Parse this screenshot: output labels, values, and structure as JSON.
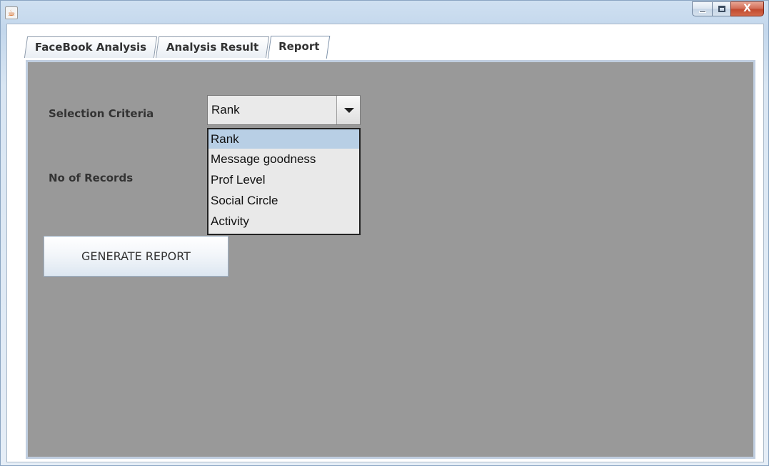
{
  "window": {
    "app_icon": "java-cup-icon",
    "controls": {
      "minimize": "minimize-icon",
      "maximize": "maximize-icon",
      "close_glyph": "X"
    }
  },
  "tabs": [
    {
      "label": "FaceBook Analysis",
      "active": false
    },
    {
      "label": "Analysis Result",
      "active": false
    },
    {
      "label": "Report",
      "active": true
    }
  ],
  "form": {
    "selection_criteria_label": "Selection Criteria",
    "records_label": "No of Records",
    "combo": {
      "selected": "Rank",
      "options": [
        "Rank",
        "Message goodness",
        "Prof Level",
        "Social Circle",
        "Activity"
      ]
    },
    "generate_button": "GENERATE REPORT"
  },
  "colors": {
    "panel_background": "#999999",
    "selected_option": "#b8cfe5"
  }
}
